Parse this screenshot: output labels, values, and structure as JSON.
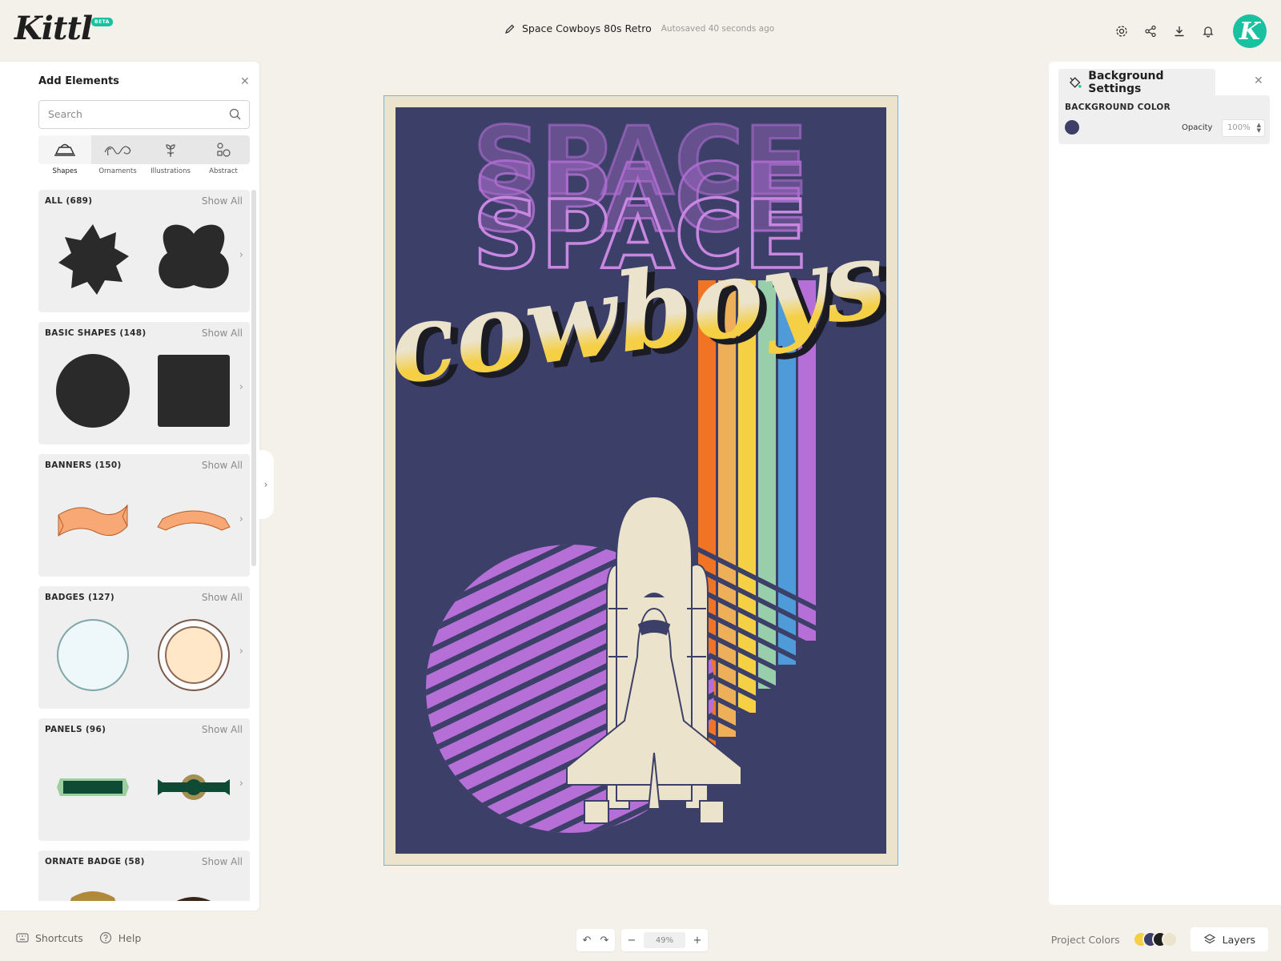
{
  "app": {
    "logo": "Kittl",
    "badge": "BETA"
  },
  "document": {
    "title": "Space Cowboys 80s Retro",
    "autosave": "Autosaved 40 seconds ago"
  },
  "header_icons": [
    "gear-icon",
    "share-icon",
    "download-icon",
    "bell-icon"
  ],
  "user": {
    "avatar_letter": "K",
    "color": "#19c1a0"
  },
  "left_rail": [
    "edit-icon",
    "layout-icon",
    "text-icon",
    "shapes-icon",
    "upload-icon",
    "camera-icon",
    "grid-icon"
  ],
  "add_elements": {
    "title": "Add Elements",
    "search_placeholder": "Search",
    "categories": [
      {
        "label": "Shapes",
        "active": true
      },
      {
        "label": "Ornaments",
        "active": false
      },
      {
        "label": "Illustrations",
        "active": false
      },
      {
        "label": "Abstract",
        "active": false
      }
    ],
    "show_all_label": "Show All",
    "sections": [
      {
        "title": "ALL (689)"
      },
      {
        "title": "BASIC SHAPES (148)"
      },
      {
        "title": "BANNERS (150)"
      },
      {
        "title": "BADGES (127)"
      },
      {
        "title": "PANELS (96)"
      },
      {
        "title": "ORNATE BADGE (58)"
      }
    ]
  },
  "artwork": {
    "headline": "SPACE",
    "script": "cowboys",
    "colors": {
      "background": "#3c4068",
      "border": "#ebe3cc",
      "purple": "#b56fd6",
      "cream": "#ebe3cc",
      "stripes": [
        "#f07424",
        "#eeaf59",
        "#f5cf44",
        "#99ceaa",
        "#4f9ad9",
        "#b56fd6"
      ]
    }
  },
  "background_settings": {
    "title": "Background Settings",
    "color_label": "BACKGROUND COLOR",
    "color": "#3c4068",
    "opacity_label": "Opacity",
    "opacity_value": "100%"
  },
  "bottom": {
    "shortcuts": "Shortcuts",
    "help": "Help",
    "zoom": "49%",
    "project_colors_label": "Project Colors",
    "project_colors": [
      "#f5cf44",
      "#3c4068",
      "#1f1f1f",
      "#ebe3cc"
    ],
    "layers": "Layers"
  }
}
